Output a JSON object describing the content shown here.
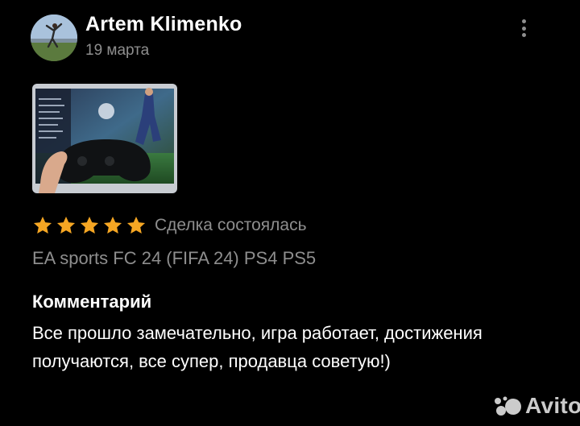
{
  "review": {
    "author": "Artem Klimenko",
    "date": "19 марта",
    "rating": 5,
    "rating_max": 5,
    "deal_status": "Сделка состоялась",
    "product": "EA sports FC 24 (FIFA 24) PS4 PS5",
    "comment_heading": "Комментарий",
    "comment_text": "Все прошло замечательно, игра работает, достижения получаются, все супер, продавца советую!)"
  },
  "icons": {
    "menu": "kebab-menu-icon",
    "star": "star-icon",
    "watermark": "avito-logo"
  },
  "watermark": {
    "text": "Avito"
  },
  "colors": {
    "background": "#000000",
    "text_primary": "#ffffff",
    "text_secondary": "#8e8e8e",
    "star": "#f5a623"
  }
}
